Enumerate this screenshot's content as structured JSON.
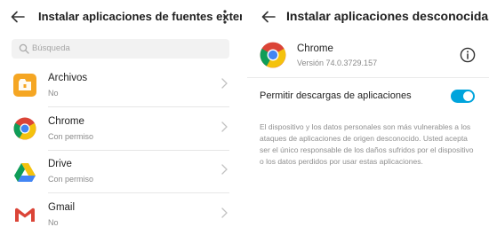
{
  "left_panel": {
    "title": "Instalar aplicaciones de fuentes externas",
    "search": {
      "placeholder": "Búsqueda"
    },
    "apps": [
      {
        "name": "Archivos",
        "status": "No",
        "icon": "files-icon"
      },
      {
        "name": "Chrome",
        "status": "Con permiso",
        "icon": "chrome-icon"
      },
      {
        "name": "Drive",
        "status": "Con permiso",
        "icon": "drive-icon"
      },
      {
        "name": "Gmail",
        "status": "No",
        "icon": "gmail-icon"
      }
    ]
  },
  "right_panel": {
    "title": "Instalar aplicaciones desconocidas",
    "app": {
      "name": "Chrome",
      "version": "Versión 74.0.3729.157",
      "icon": "chrome-icon"
    },
    "toggle": {
      "label": "Permitir descargas de aplicaciones",
      "enabled": true
    },
    "notice": "El dispositivo y los datos personales son más vulnerables a los ataques de aplicaciones de origen desconocido. Usted acepta ser el único responsable de los daños sufridos por el dispositivo o los datos perdidos por usar estas aplicaciones."
  },
  "colors": {
    "accent": "#00a4dc",
    "files_orange": "#f5a623",
    "chrome_red": "#db4437",
    "chrome_yellow": "#f4c20d",
    "chrome_green": "#0f9d58",
    "chrome_blue": "#4285f4"
  }
}
